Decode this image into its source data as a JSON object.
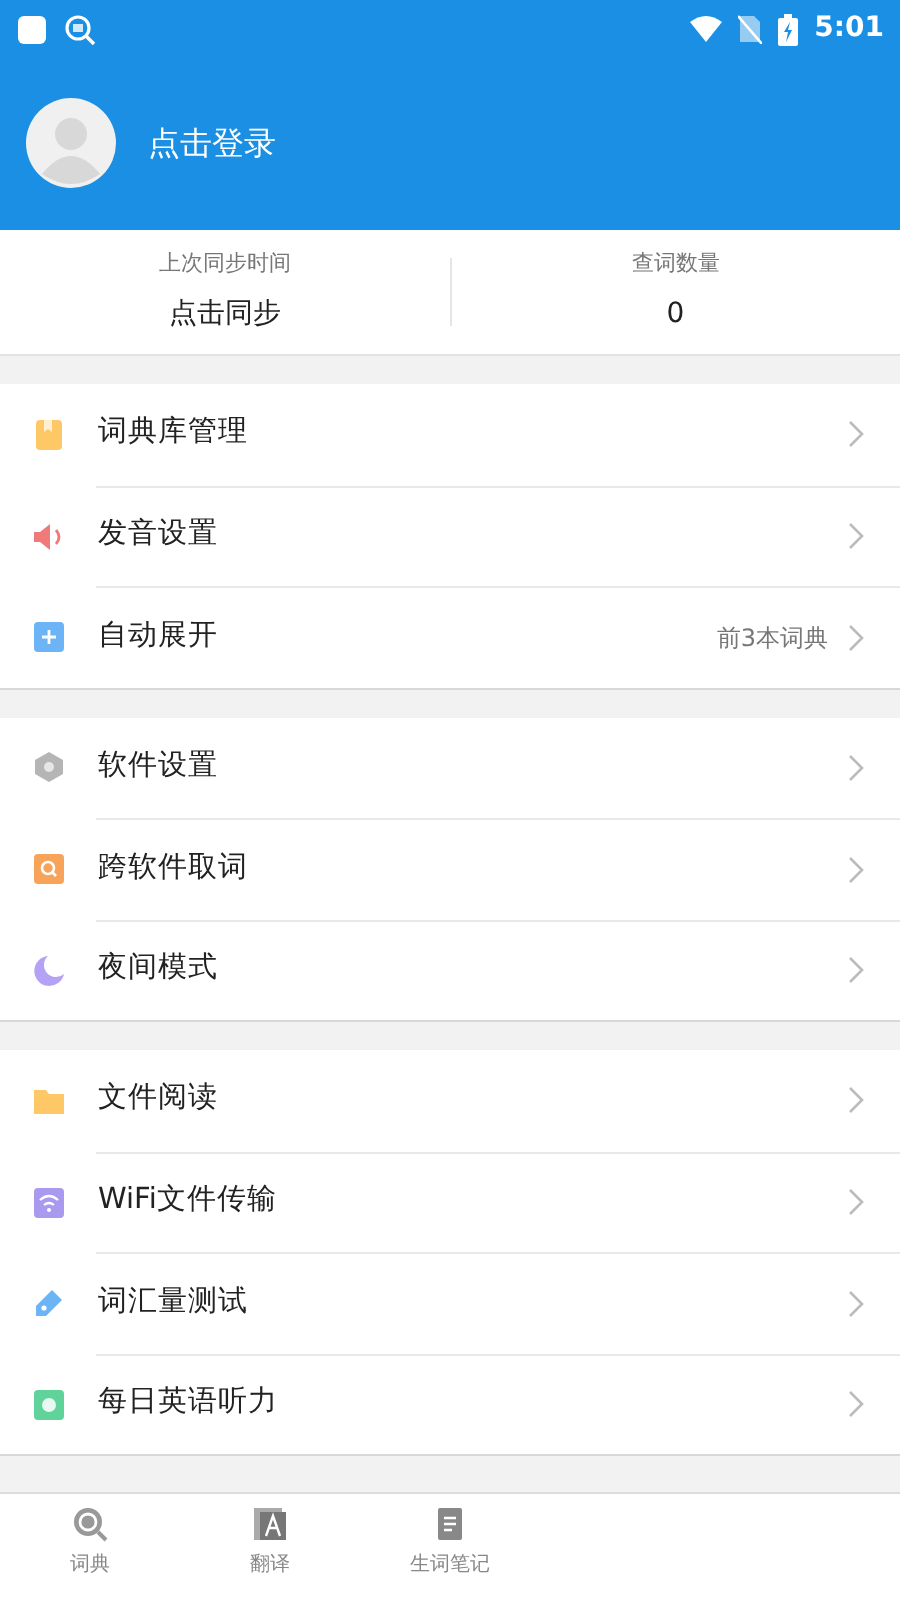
{
  "status_bar": {
    "time": "5:01"
  },
  "profile": {
    "login": "点击登录"
  },
  "sync": [
    {
      "label": "上次同步时间",
      "value": "点击同步"
    },
    {
      "label": "查词数量",
      "value": "0"
    }
  ],
  "menu_groups": [
    {
      "items": [
        {
          "label": "词典库管理"
        },
        {
          "label": "发音设置"
        },
        {
          "label": "自动展开",
          "value": "前3本词典"
        }
      ]
    },
    {
      "items": [
        {
          "label": "软件设置"
        },
        {
          "label": "跨软件取词"
        },
        {
          "label": "夜间模式"
        }
      ]
    },
    {
      "items": [
        {
          "label": "文件阅读"
        },
        {
          "label": "WiFi文件传输"
        },
        {
          "label": "词汇量测试"
        },
        {
          "label": "每日英语听力"
        }
      ]
    }
  ],
  "bottom_tabs": [
    {
      "label": "词典",
      "selected": false
    },
    {
      "label": "翻译",
      "selected": false
    },
    {
      "label": "生词笔记",
      "selected": false
    }
  ]
}
